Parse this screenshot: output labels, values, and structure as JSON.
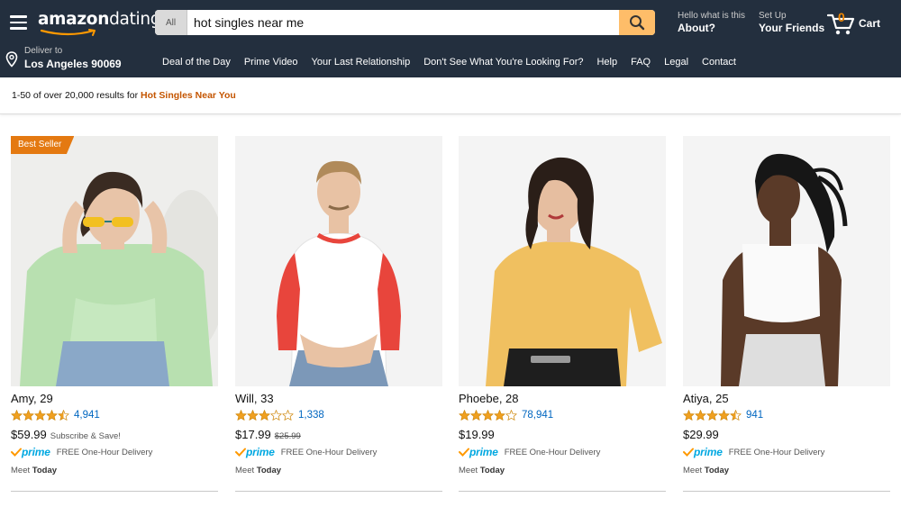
{
  "header": {
    "logo_primary": "amazon",
    "logo_secondary": "dating",
    "search_category": "All",
    "search_value": "hot singles near me",
    "about_line1": "Hello what is this",
    "about_line2": "About?",
    "friends_line1": "Set Up",
    "friends_line2": "Your Friends",
    "cart_count": "0",
    "cart_label": "Cart",
    "deliver_line1": "Deliver to",
    "deliver_line2": "Los Angeles 90069"
  },
  "nav": {
    "items": [
      "Deal of the Day",
      "Prime Video",
      "Your Last Relationship",
      "Don't See What You're Looking For?",
      "Help",
      "FAQ",
      "Legal",
      "Contact"
    ]
  },
  "results": {
    "prefix": "1-50 of over 20,000 results for ",
    "query": "Hot Singles Near You"
  },
  "products": [
    {
      "badge": "Best Seller",
      "name": "Amy, 29",
      "rating": 4.5,
      "reviews": "4,941",
      "price": "$59.99",
      "price_note": "Subscribe & Save!",
      "price_old": "",
      "prime_label": "prime",
      "delivery": "FREE One-Hour Delivery",
      "meet_prefix": "Meet ",
      "meet_day": "Today",
      "photo": {
        "bg": "#eeeeec",
        "top": "#b8e0b0",
        "bottom": "#8aa8c8",
        "hair": "#3a2b22",
        "skin": "#e8c4a8",
        "accessory": "yellow-sunglasses"
      }
    },
    {
      "badge": "",
      "name": "Will, 33",
      "rating": 3.0,
      "reviews": "1,338",
      "price": "$17.99",
      "price_note": "",
      "price_old": "$25.99",
      "prime_label": "prime",
      "delivery": "FREE One-Hour Delivery",
      "meet_prefix": "Meet ",
      "meet_day": "Today",
      "photo": {
        "bg": "#f3f3f3",
        "top": "#ffffff",
        "sleeves": "#e8453c",
        "bottom": "#7c98b8",
        "hair": "#b08a5a",
        "skin": "#e8c2a4"
      }
    },
    {
      "badge": "",
      "name": "Phoebe, 28",
      "rating": 4.0,
      "reviews": "78,941",
      "price": "$19.99",
      "price_note": "",
      "price_old": "",
      "prime_label": "prime",
      "delivery": "FREE One-Hour Delivery",
      "meet_prefix": "Meet ",
      "meet_day": "Today",
      "photo": {
        "bg": "#f4f4f4",
        "top": "#f0c060",
        "bottom": "#1e1e1e",
        "hair": "#2a1e18",
        "skin": "#e6bea0"
      }
    },
    {
      "badge": "",
      "name": "Atiya, 25",
      "rating": 4.5,
      "reviews": "941",
      "price": "$29.99",
      "price_note": "",
      "price_old": "",
      "prime_label": "prime",
      "delivery": "FREE One-Hour Delivery",
      "meet_prefix": "Meet ",
      "meet_day": "Today",
      "photo": {
        "bg": "#f4f4f4",
        "top": "#fafafa",
        "bottom": "#dedede",
        "hair": "#161616",
        "skin": "#5a3a28"
      }
    }
  ],
  "colors": {
    "header_bg": "#232f3e",
    "search_button": "#febd69",
    "accent_orange": "#e47911",
    "link_blue": "#0066c0",
    "star": "#f0a020",
    "prime_blue": "#00a8e1",
    "query_orange": "#c45500"
  }
}
